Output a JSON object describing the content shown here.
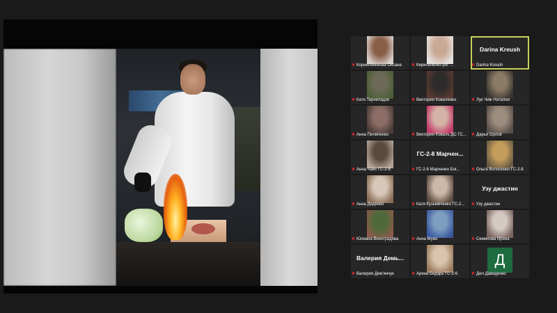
{
  "participants": [
    {
      "name": "Корнилиенкова Оксана",
      "type": "video",
      "video_colors": [
        "#8a5f49",
        "#d8cfc9"
      ]
    },
    {
      "name": "Кирильченко-рог ...",
      "type": "video",
      "video_colors": [
        "#c9a894",
        "#e6e1df"
      ]
    },
    {
      "name": "Darina Kreush",
      "type": "name",
      "big_text": "Darina Kreush",
      "active": true
    },
    {
      "name": "Катя Тернеладзе",
      "type": "video",
      "video_colors": [
        "#6c6a56",
        "#4c5f38"
      ]
    },
    {
      "name": "Виктория Коваленко",
      "type": "video",
      "video_colors": [
        "#2d2b2b",
        "#5a3a32"
      ]
    },
    {
      "name": "Лук Чиж Наталия",
      "type": "video",
      "video_colors": [
        "#8a7a66",
        "#3c3530"
      ]
    },
    {
      "name": "Анна Пилипенко",
      "type": "video",
      "video_colors": [
        "#8c6e66",
        "#4b3b37"
      ]
    },
    {
      "name": "Виктория Коваль ДС ГС...",
      "type": "video",
      "video_colors": [
        "#d3b4a6",
        "#c23b69"
      ]
    },
    {
      "name": "Дарья Орлов",
      "type": "video",
      "video_colors": [
        "#9c8c7e",
        "#5a5049"
      ]
    },
    {
      "name": "Анна Чайс ГС-2-8",
      "type": "video",
      "video_colors": [
        "#5b4a3c",
        "#b3a397"
      ]
    },
    {
      "name": "ГС-2-8 Марченко Бог...",
      "type": "name",
      "big_text": "ГС-2-8 Марчен..."
    },
    {
      "name": "Ольга Волосенко ГС-2-8",
      "type": "video",
      "video_colors": [
        "#c49e5a",
        "#6a5a45"
      ]
    },
    {
      "name": "Анна Диденко",
      "type": "video",
      "video_colors": [
        "#d8c7b8",
        "#8a6e58"
      ]
    },
    {
      "name": "Катя Кузьмиченко ГС-2...",
      "type": "video",
      "video_colors": [
        "#cdb8a8",
        "#5a4a40"
      ]
    },
    {
      "name": "Узу джастин",
      "type": "name",
      "big_text": "Узу джастин"
    },
    {
      "name": "Юлиана Виноградова",
      "type": "video",
      "video_colors": [
        "#4e6a3a",
        "#8a5a4a"
      ]
    },
    {
      "name": "Анна Мумс",
      "type": "video",
      "video_colors": [
        "#7e9dc0",
        "#3a5aa0"
      ]
    },
    {
      "name": "Семенова Ирена",
      "type": "video",
      "video_colors": [
        "#d5c9c4",
        "#7a6660"
      ]
    },
    {
      "name": "Валерия Дем'янчук",
      "type": "name",
      "big_text": "Валерия Демь..."
    },
    {
      "name": "Арина Бедарь ГС-2-6",
      "type": "video",
      "video_colors": [
        "#d9c4ad",
        "#9a7a5e"
      ]
    },
    {
      "name": "Дил Давиденко",
      "type": "avatar",
      "avatar_letter": "Д",
      "avatar_color": "#1e6b3f"
    }
  ],
  "accent_active": "#c9d35a",
  "mute_color": "#e02a2a"
}
